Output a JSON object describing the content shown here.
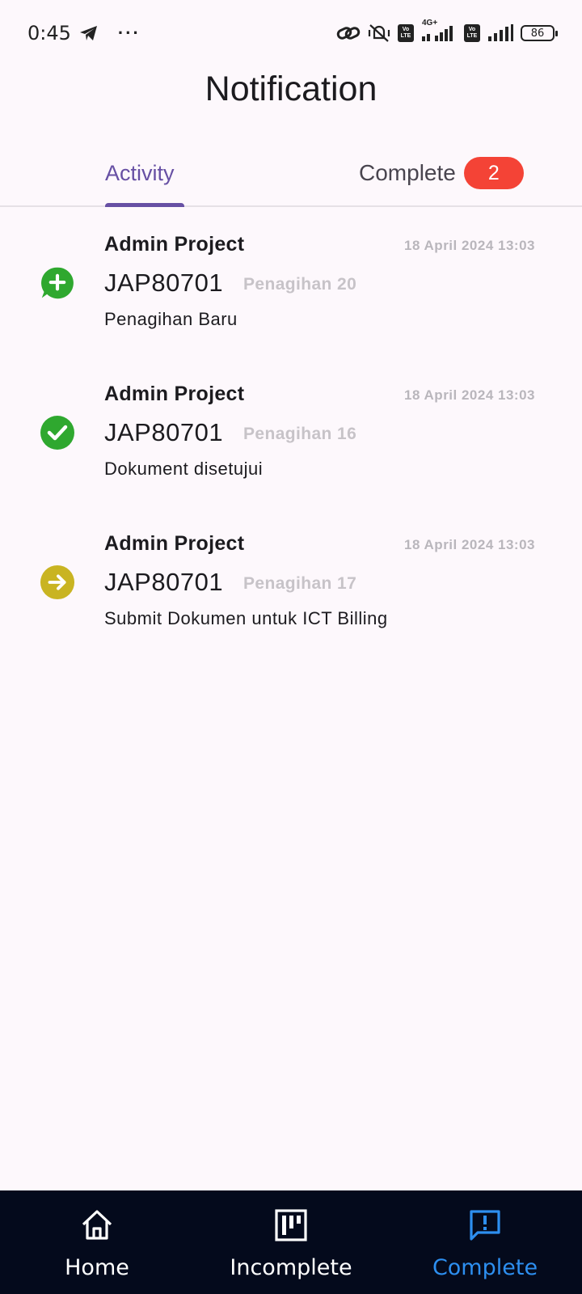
{
  "status_bar": {
    "time": "0:45",
    "dots": "···",
    "network": "4G+",
    "volte_top": "Vo",
    "volte_bottom": "LTE",
    "battery": "86"
  },
  "header": {
    "title": "Notification"
  },
  "tabs": [
    {
      "label": "Activity",
      "active": true
    },
    {
      "label": "Complete",
      "badge": "2",
      "active": false
    }
  ],
  "notifications": [
    {
      "sender": "Admin Project",
      "time": "18 April 2024 13:03",
      "code": "JAP80701",
      "reference": "Penagihan 20",
      "message": "Penagihan Baru",
      "icon": "add-chat-icon",
      "color": "#2fa82f"
    },
    {
      "sender": "Admin Project",
      "time": "18 April 2024 13:03",
      "code": "JAP80701",
      "reference": "Penagihan 16",
      "message": "Dokument disetujui",
      "icon": "check-circle-icon",
      "color": "#2fa82f"
    },
    {
      "sender": "Admin Project",
      "time": "18 April 2024 13:03",
      "code": "JAP80701",
      "reference": "Penagihan 17",
      "message": "Submit Dokumen untuk ICT Billing",
      "icon": "arrow-right-circle-icon",
      "color": "#c9b422"
    }
  ],
  "bottom_nav": [
    {
      "label": "Home",
      "icon": "home-icon",
      "active": false
    },
    {
      "label": "Incomplete",
      "icon": "board-icon",
      "active": false
    },
    {
      "label": "Complete",
      "icon": "alert-message-icon",
      "active": true
    }
  ],
  "colors": {
    "background": "#fdf8fc",
    "tab_active": "#6750a4",
    "badge": "#f44336",
    "nav_background": "#040a1c",
    "nav_active": "#2d8ff0"
  }
}
